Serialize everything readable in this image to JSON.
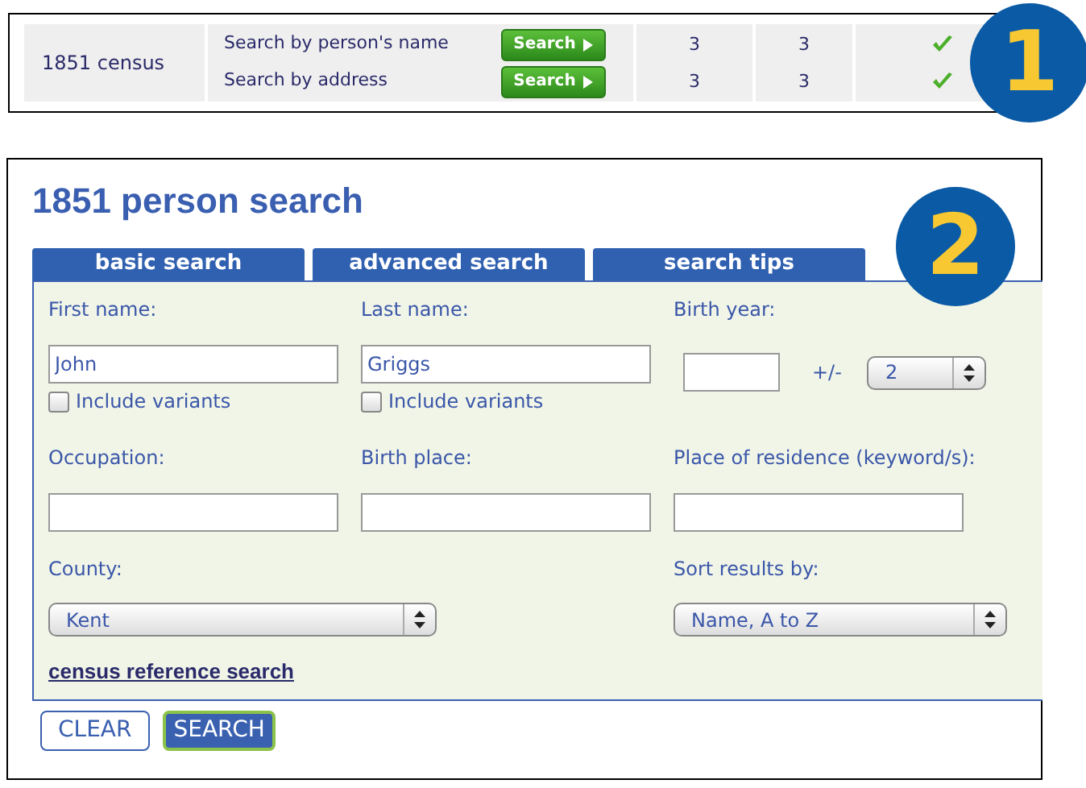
{
  "census_table": {
    "badge": "1",
    "rows": [
      {
        "census": "1851 census",
        "searches": [
          {
            "label": "Search by person's name",
            "button": "Search",
            "column_3": "3",
            "column_4": "3",
            "available": true
          },
          {
            "label": "Search by address",
            "button": "Search",
            "column_3": "3",
            "column_4": "3",
            "available": true
          }
        ]
      }
    ]
  },
  "person_search": {
    "title": "1851 person search",
    "badge": "2",
    "tabs": [
      "basic search",
      "advanced search",
      "search tips"
    ],
    "first_name": {
      "label": "First name:",
      "value": "John",
      "variants": {
        "label": "Include variants",
        "checked": false
      }
    },
    "last_name": {
      "label": "Last name:",
      "value": "Griggs",
      "variants": {
        "label": "Include variants",
        "checked": false
      }
    },
    "birth_year": {
      "label": "Birth year:",
      "range_label": "+/-",
      "range": "2"
    },
    "occupation": {
      "label": "Occupation:"
    },
    "birth_place": {
      "label": "Birth place:"
    },
    "residence": {
      "label": "Place of residence (keyword/s):"
    },
    "county": {
      "label": "County:",
      "value": "Kent"
    },
    "sort": {
      "label": "Sort results by:",
      "value": "Name, A to Z"
    },
    "link": "census reference search",
    "buttons": [
      "CLEAR",
      "SEARCH"
    ]
  }
}
